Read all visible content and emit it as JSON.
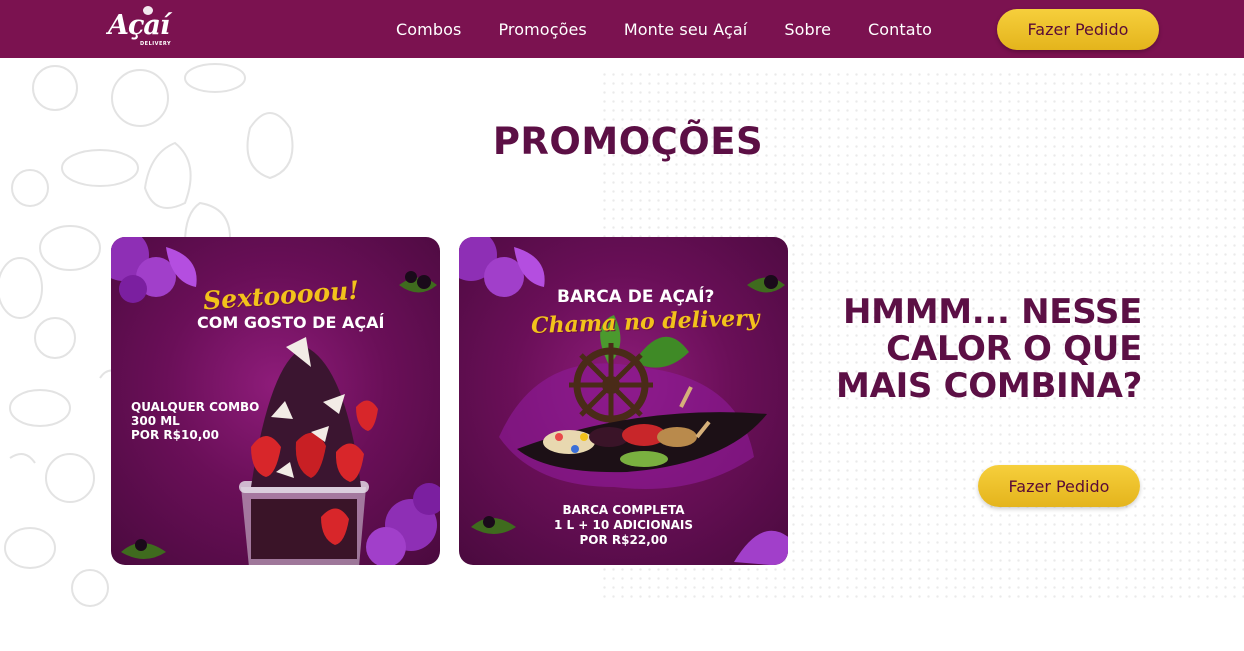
{
  "nav": {
    "logo_text": "Açaí",
    "logo_sub": "DELIVERY",
    "links": [
      "Combos",
      "Promoções",
      "Monte seu Açaí",
      "Sobre",
      "Contato"
    ],
    "cta_label": "Fazer Pedido"
  },
  "section": {
    "title": "PROMOÇÕES"
  },
  "cards": [
    {
      "script": "Sextoooou!",
      "headline": "COM GOSTO DE AÇAÍ",
      "details": [
        "QUALQUER COMBO",
        "300 ML",
        "POR R$10,00"
      ]
    },
    {
      "headline": "BARCA DE AÇAÍ?",
      "script": "Chama no delivery",
      "details": [
        "BARCA COMPLETA",
        "1 L + 10 ADICIONAIS",
        "POR R$22,00"
      ]
    }
  ],
  "hero": {
    "lines": [
      "HMMM... NESSE",
      "CALOR O QUE",
      "MAIS COMBINA?"
    ],
    "cta_label": "Fazer Pedido"
  },
  "colors": {
    "brand_purple": "#7b1250",
    "title_purple": "#5c0f45",
    "accent_yellow": "#f2c21b"
  }
}
